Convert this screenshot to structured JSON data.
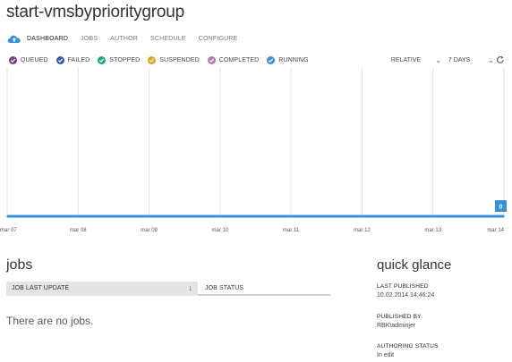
{
  "page_title": "start-vmsbyprioritygroup",
  "nav": {
    "tabs": [
      {
        "label": "DASHBOARD"
      },
      {
        "label": "JOBS"
      },
      {
        "label": "AUTHOR"
      },
      {
        "label": "SCHEDULE"
      },
      {
        "label": "CONFIGURE"
      }
    ],
    "active_tab": "DASHBOARD"
  },
  "legend": [
    {
      "label": "QUEUED",
      "color": "#7a3d8a"
    },
    {
      "label": "FAILED",
      "color": "#3a5aa8"
    },
    {
      "label": "STOPPED",
      "color": "#1aa68a"
    },
    {
      "label": "SUSPENDED",
      "color": "#d9a22a"
    },
    {
      "label": "COMPLETED",
      "color": "#b07ab8"
    },
    {
      "label": "RUNNING",
      "color": "#3c8fd6"
    }
  ],
  "controls": {
    "relative_label": "RELATIVE",
    "range_label": "7 DAYS"
  },
  "chart_data": {
    "type": "area",
    "x": [
      "mar 07",
      "mar 08",
      "mar 09",
      "mar 10",
      "mar 11",
      "mar 12",
      "mar 13",
      "mar 14"
    ],
    "series": [
      {
        "values": [
          0,
          0,
          0,
          0,
          0,
          0,
          0,
          0
        ],
        "color": "#3c8fd6"
      }
    ],
    "latest_value_label": "0",
    "grid": true
  },
  "jobs": {
    "title": "jobs",
    "columns": [
      "JOB LAST UPDATE",
      "JOB STATUS"
    ],
    "empty_text": "There are no jobs."
  },
  "quick_glance": {
    "title": "quick glance",
    "items": [
      {
        "label": "LAST PUBLISHED",
        "value": "10.02.2014 14:46:24"
      },
      {
        "label": "PUBLISHED BY",
        "value": "RBK\\adminjer"
      },
      {
        "label": "AUTHORING STATUS",
        "value": "In edit"
      }
    ]
  }
}
